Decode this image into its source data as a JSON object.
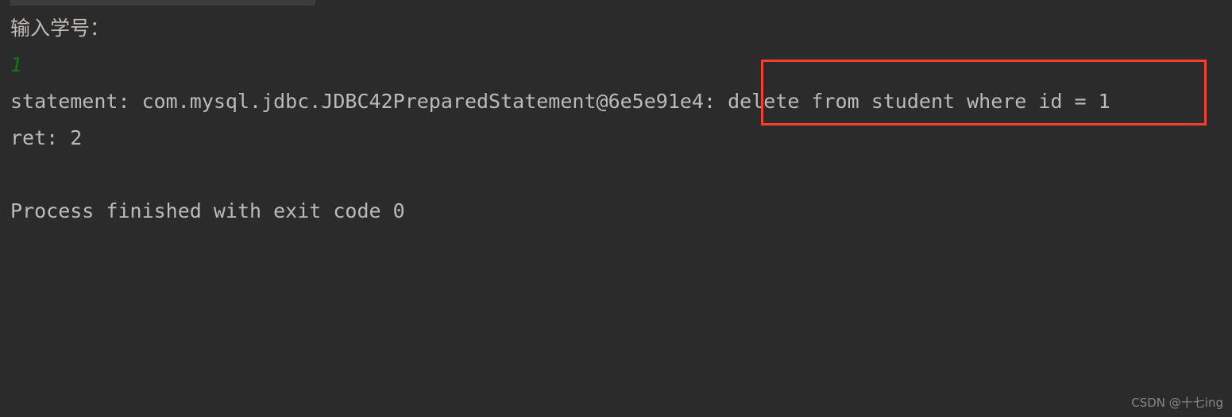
{
  "window": {
    "title": "Run console output",
    "background_color": "#2b2b2b",
    "text_color": "#bbbbbb"
  },
  "scrollbar": {
    "name": "horizontal-scrollbar",
    "thumb_color": "#3c3c3c",
    "orientation": "horizontal"
  },
  "console": {
    "lines": [
      {
        "id": "prompt",
        "text": "输入学号：",
        "kind": "program-prompt",
        "color": "#c0bbb2"
      },
      {
        "id": "stdin",
        "text": "1",
        "kind": "user-input-echo",
        "color": "#0b7b11"
      },
      {
        "id": "statement",
        "text": "statement: com.mysql.jdbc.JDBC42PreparedStatement@6e5e91e4: delete from student where id = 1",
        "kind": "stdout",
        "color": "#bbbbbb"
      },
      {
        "id": "ret",
        "text": "ret: 2",
        "kind": "stdout",
        "color": "#bbbbbb"
      },
      {
        "id": "process",
        "text": "Process finished with exit code 0",
        "kind": "process-status",
        "color": "#bbbbbb"
      }
    ],
    "statement_parts": {
      "prefix": "statement: com.mysql.jdbc.JDBC42PreparedStatement@6e5e91e4: ",
      "sql": "delete from student where id = 1"
    },
    "return_value": "2",
    "exit_code": "0",
    "input_value": "1"
  },
  "annotation": {
    "name": "sql-highlight-box",
    "target_text": "delete from student where id = 1",
    "color": "#f4402f",
    "border_width_px": 3
  },
  "watermark": {
    "text": "CSDN @十七ing",
    "color": "#8d8d8d"
  }
}
